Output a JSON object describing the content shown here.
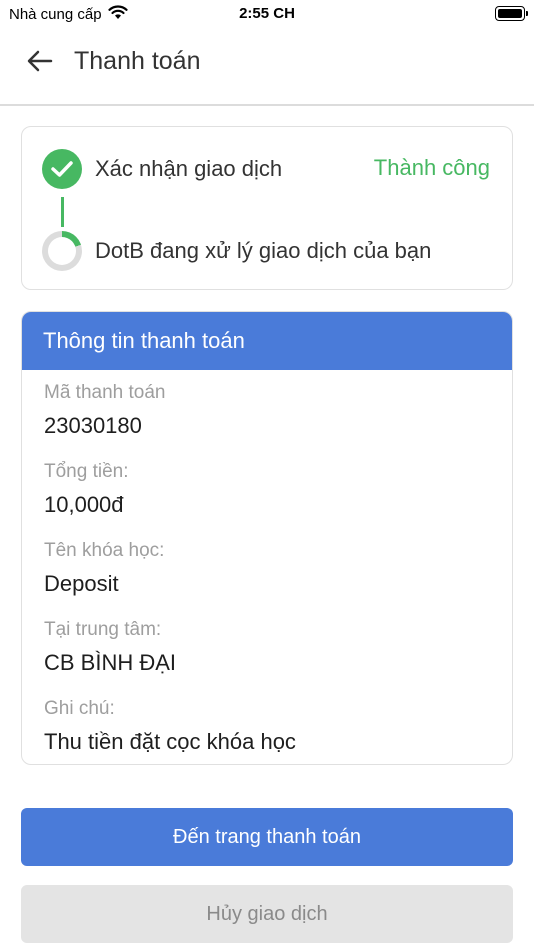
{
  "status_bar": {
    "carrier": "Nhà cung cấp",
    "time": "2:55 CH",
    "wifi_icon": "wifi-icon",
    "battery_icon": "battery-icon"
  },
  "header": {
    "title": "Thanh toán",
    "back_icon": "arrow-left-icon"
  },
  "transaction_status": {
    "steps": [
      {
        "label": "Xác nhận giao dịch",
        "status": "Thành công",
        "icon": "check-circle-icon"
      },
      {
        "label": "DotB đang xử lý giao dịch của bạn",
        "icon": "loading-spinner-icon",
        "progress": 0.2
      }
    ]
  },
  "payment_info": {
    "title": "Thông tin thanh toán",
    "fields": [
      {
        "label": "Mã thanh toán",
        "value": "23030180"
      },
      {
        "label": "Tổng tiền:",
        "value": "10,000đ"
      },
      {
        "label": "Tên khóa học:",
        "value": "Deposit"
      },
      {
        "label": "Tại trung tâm:",
        "value": "CB BÌNH ĐẠI"
      },
      {
        "label": "Ghi chú:",
        "value": "Thu tiền đặt cọc khóa học"
      }
    ]
  },
  "actions": {
    "primary_label": "Đến trang thanh toán",
    "secondary_label": "Hủy giao dịch"
  },
  "colors": {
    "accent": "#4a7bd9",
    "success": "#47b862",
    "muted_button": "#e4e4e4"
  }
}
